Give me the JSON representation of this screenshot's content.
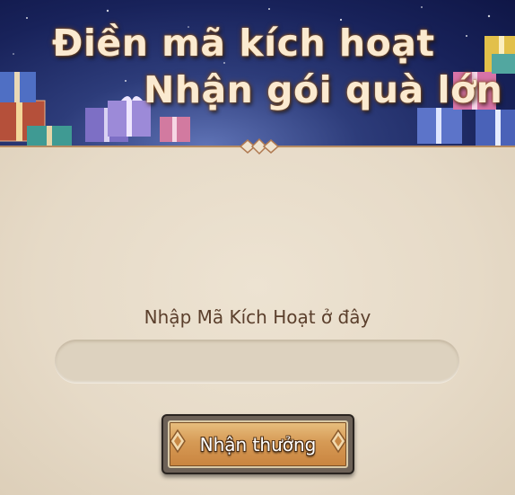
{
  "banner": {
    "title_line1": "Điền mã kích hoạt",
    "title_line2": "Nhận gói quà lớn"
  },
  "form": {
    "label": "Nhập Mã Kích Hoạt ở đây",
    "code_value": "",
    "submit_label": "Nhận thưởng"
  },
  "icons": [
    "gift-box-icon",
    "diamond-ornament-icon"
  ],
  "colors": {
    "banner_bg": "#1f2a66",
    "panel_bg": "#e7dccb",
    "label_text": "#5b3f2c",
    "button_fill": "#d69a55",
    "button_frame": "#2a2420"
  }
}
